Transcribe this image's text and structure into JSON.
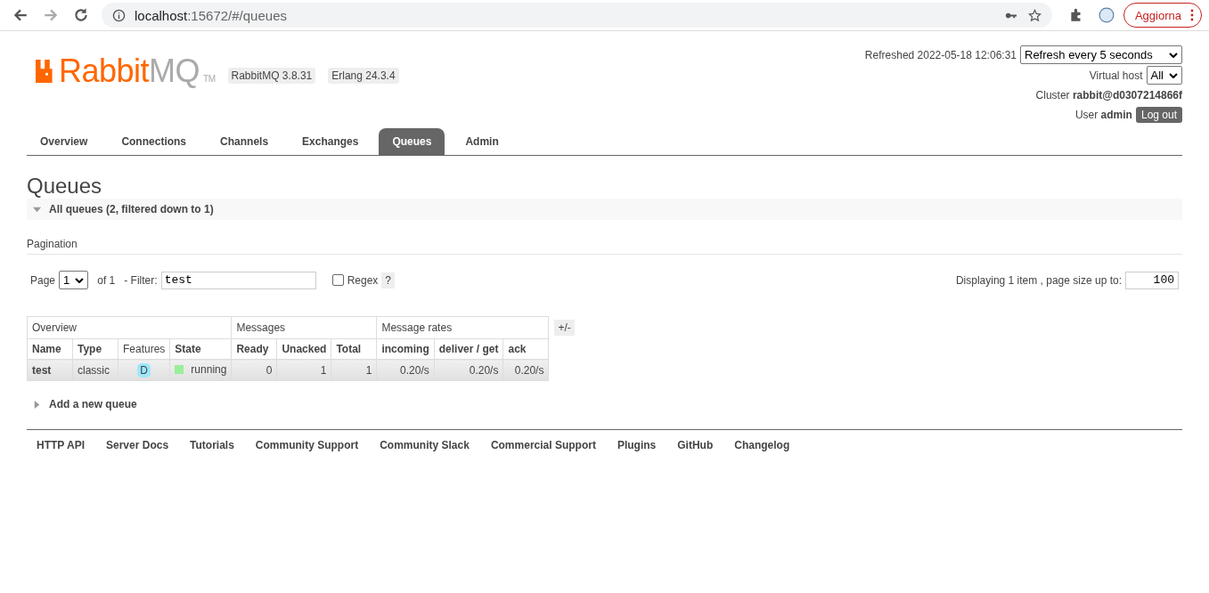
{
  "browser": {
    "url_host": "localhost",
    "url_path": ":15672/#/queues",
    "update_button": "Aggiorna"
  },
  "header": {
    "logo_primary": "Rabbit",
    "logo_secondary": "MQ",
    "logo_mark": "TM",
    "versions": [
      "RabbitMQ 3.8.31",
      "Erlang 24.3.4"
    ],
    "refreshed": "Refreshed 2022-05-18 12:06:31",
    "refresh_select": "Refresh every 5 seconds",
    "vhost_label": "Virtual host",
    "vhost_select": "All",
    "cluster_label": "Cluster",
    "cluster_name": "rabbit@d0307214866f",
    "user_label": "User",
    "user_name": "admin",
    "logout": "Log out"
  },
  "tabs": [
    {
      "label": "Overview",
      "selected": false
    },
    {
      "label": "Connections",
      "selected": false
    },
    {
      "label": "Channels",
      "selected": false
    },
    {
      "label": "Exchanges",
      "selected": false
    },
    {
      "label": "Queues",
      "selected": true
    },
    {
      "label": "Admin",
      "selected": false
    }
  ],
  "page_title": "Queues",
  "section": {
    "title": "All queues (2, filtered down to 1)",
    "expanded": true
  },
  "pagination": {
    "heading": "Pagination",
    "page_label": "Page",
    "page_select": "1",
    "of_pages": "of 1",
    "filter_label": "- Filter:",
    "filter_value": "test",
    "regex_checked": false,
    "regex_label": "Regex",
    "help": "?",
    "displaying": "Displaying 1 item , page size up to:",
    "page_size": "100"
  },
  "table": {
    "groups": [
      {
        "label": "Overview"
      },
      {
        "label": "Messages"
      },
      {
        "label": "Message rates"
      }
    ],
    "columns": [
      {
        "label": "Name",
        "emphasis": true
      },
      {
        "label": "Type",
        "emphasis": true
      },
      {
        "label": "Features",
        "emphasis": false
      },
      {
        "label": "State",
        "emphasis": true
      },
      {
        "label": "Ready",
        "emphasis": true
      },
      {
        "label": "Unacked",
        "emphasis": true
      },
      {
        "label": "Total",
        "emphasis": true
      },
      {
        "label": "incoming",
        "emphasis": true
      },
      {
        "label": "deliver / get",
        "emphasis": true
      },
      {
        "label": "ack",
        "emphasis": true
      }
    ],
    "rows": [
      {
        "name": "test",
        "type": "classic",
        "feature": "D",
        "state": "running",
        "ready": "0",
        "unacked": "1",
        "total": "1",
        "incoming": "0.20/s",
        "deliver_get": "0.20/s",
        "ack": "0.20/s"
      }
    ],
    "toggle": "+/-"
  },
  "add_section": {
    "title": "Add a new queue",
    "expanded": false
  },
  "footer_links": [
    "HTTP API",
    "Server Docs",
    "Tutorials",
    "Community Support",
    "Community Slack",
    "Commercial Support",
    "Plugins",
    "GitHub",
    "Changelog"
  ]
}
